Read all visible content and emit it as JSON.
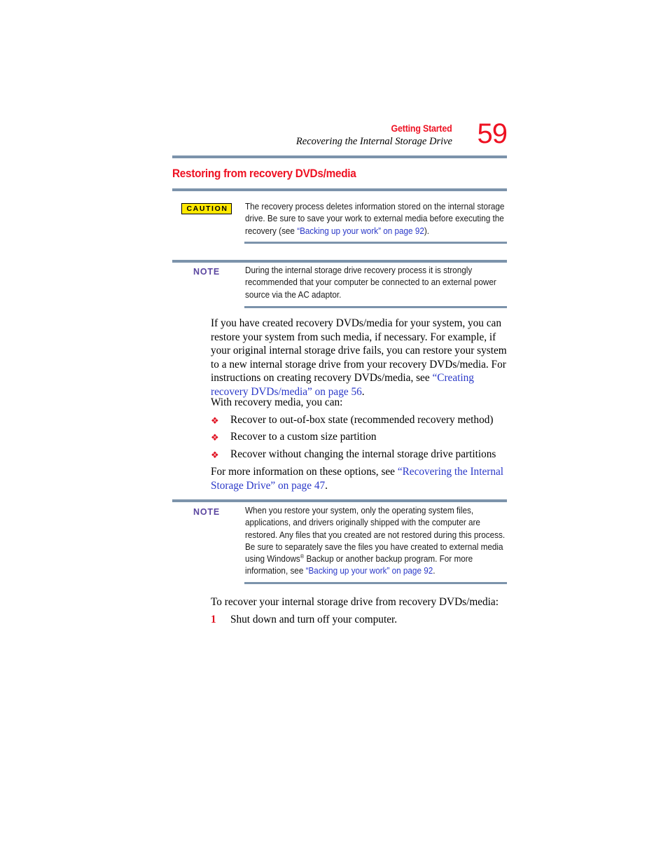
{
  "header": {
    "chapter": "Getting Started",
    "section": "Recovering the Internal Storage Drive",
    "page_number": "59"
  },
  "section_title": "Restoring from recovery DVDs/media",
  "colors": {
    "accent_red": "#ee1122",
    "rule_blue_gray": "#7c93ab",
    "link_blue": "#2a38c8",
    "note_purple": "#5b46a0",
    "caution_yellow": "#ffe800",
    "bullet_red": "#e01020"
  },
  "caution": {
    "label": "CAUTION",
    "text_before_link": "The recovery process deletes information stored on the internal storage drive. Be sure to save your work to external media before executing the recovery (see ",
    "link": "“Backing up your work” on page 92",
    "text_after_link": ")."
  },
  "note_one": {
    "label": "NOTE",
    "text": "During the internal storage drive recovery process it is strongly recommended that your computer be connected to an external power source via the AC adaptor."
  },
  "paragraph_one": {
    "text_before_link": "If you have created recovery DVDs/media for your system, you can restore your system from such media, if necessary. For example, if your original internal storage drive fails, you can restore your system to a new internal storage drive from your recovery DVDs/media. For instructions on creating recovery DVDs/media, see ",
    "link": "“Creating recovery DVDs/media” on page 56",
    "text_after_link": "."
  },
  "list_intro": "With recovery media, you can:",
  "bullet_glyph": "❖",
  "bullets": [
    "Recover to out-of-box state (recommended recovery method)",
    "Recover to a custom size partition",
    "Recover without changing the internal storage drive partitions"
  ],
  "paragraph_two": {
    "text_before_link": "For more information on these options, see ",
    "link": "“Recovering the Internal Storage Drive” on page 47",
    "text_after_link": "."
  },
  "note_two": {
    "label": "NOTE",
    "text_part_one": "When you restore your system, only the operating system files, applications, and drivers originally shipped with the computer are restored. Any files that you created are not restored during this process. Be sure to separately save the files you have created to external media using Windows",
    "registered_mark": "®",
    "text_part_two": " Backup or another backup program. For more information, see ",
    "link": "“Backing up your work” on page 92",
    "text_after_link": "."
  },
  "closing_intro": "To recover your internal storage drive from recovery DVDs/media:",
  "steps": [
    {
      "number": "1",
      "text": "Shut down and turn off your computer."
    }
  ]
}
